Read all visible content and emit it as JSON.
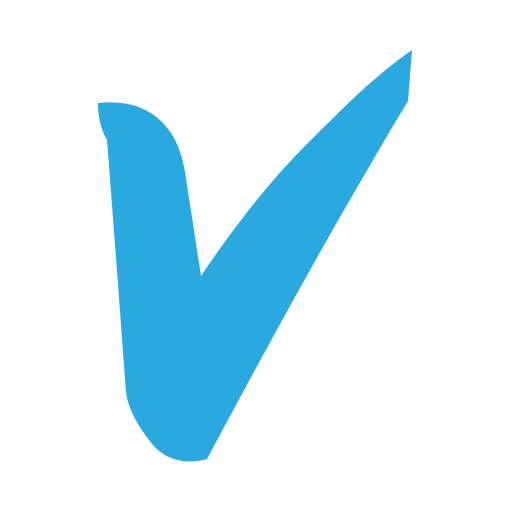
{
  "image": {
    "background_color": "#ffffff",
    "icon": {
      "name": "checkmark-icon",
      "color": "#29a9e0"
    }
  }
}
